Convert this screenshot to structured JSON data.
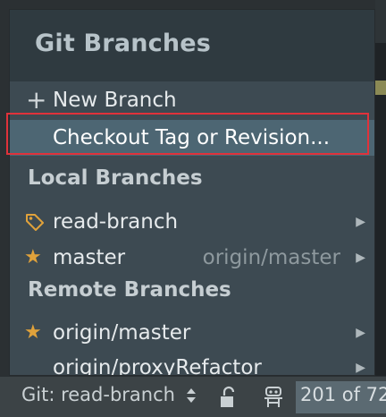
{
  "popup": {
    "title": "Git Branches",
    "new_branch": {
      "icon": "plus-icon",
      "label": "New Branch"
    },
    "checkout": {
      "label": "Checkout Tag or Revision..."
    },
    "local_header": "Local Branches",
    "local_branches": [
      {
        "name": "read-branch",
        "icon": "tag-icon",
        "tracking": ""
      },
      {
        "name": "master",
        "icon": "star-icon",
        "tracking": "origin/master"
      }
    ],
    "remote_header": "Remote Branches",
    "remote_branches": [
      {
        "name": "origin/master",
        "icon": "star-icon"
      },
      {
        "name": "origin/proxyRefactor",
        "icon": ""
      }
    ]
  },
  "status_bar": {
    "git_label": "Git: read-branch",
    "position_text": "201 of 72"
  },
  "colors": {
    "selection": "#4d6673",
    "highlight_border": "#e0323b",
    "star": "#e0a23b"
  }
}
